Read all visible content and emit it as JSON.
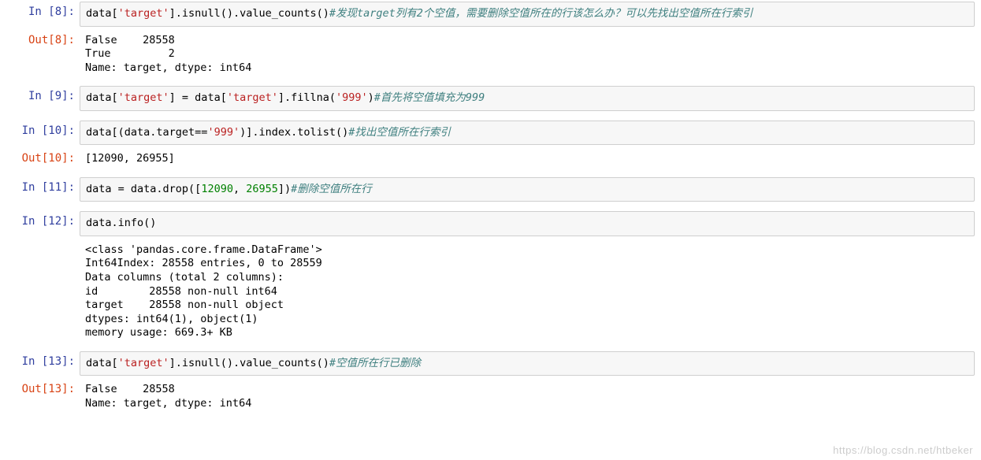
{
  "cells": {
    "in8": {
      "prompt": "In [8]:",
      "code_plain_pre": "data[",
      "str1": "'target'",
      "code_plain_mid": "].isnull().value_counts()",
      "comment": "#发现target列有2个空值，需要删除空值所在的行该怎么办？可以先找出空值所在行索引"
    },
    "out8": {
      "prompt": "Out[8]:",
      "text": "False    28558\nTrue         2\nName: target, dtype: int64"
    },
    "in9": {
      "prompt": "In [9]:",
      "p1": "data[",
      "s1": "'target'",
      "p2": "] = data[",
      "s2": "'target'",
      "p3": "].fillna(",
      "s3": "'999'",
      "p4": ")",
      "comment": "#首先将空值填充为999"
    },
    "in10": {
      "prompt": "In [10]:",
      "p1": "data[(data.target==",
      "s1": "'999'",
      "p2": ")].index.tolist()",
      "comment": "#找出空值所在行索引"
    },
    "out10": {
      "prompt": "Out[10]:",
      "text": "[12090, 26955]"
    },
    "in11": {
      "prompt": "In [11]:",
      "p1": "data = data.drop([",
      "n1": "12090",
      "p2": ", ",
      "n2": "26955",
      "p3": "])",
      "comment": "#删除空值所在行"
    },
    "in12": {
      "prompt": "In [12]:",
      "code": "data.info()"
    },
    "out12": {
      "text": "<class 'pandas.core.frame.DataFrame'>\nInt64Index: 28558 entries, 0 to 28559\nData columns (total 2 columns):\nid        28558 non-null int64\ntarget    28558 non-null object\ndtypes: int64(1), object(1)\nmemory usage: 669.3+ KB"
    },
    "in13": {
      "prompt": "In [13]:",
      "p1": "data[",
      "s1": "'target'",
      "p2": "].isnull().value_counts()",
      "comment": "#空值所在行已删除"
    },
    "out13": {
      "prompt": "Out[13]:",
      "text": "False    28558\nName: target, dtype: int64"
    }
  },
  "watermark": "https://blog.csdn.net/htbeker"
}
